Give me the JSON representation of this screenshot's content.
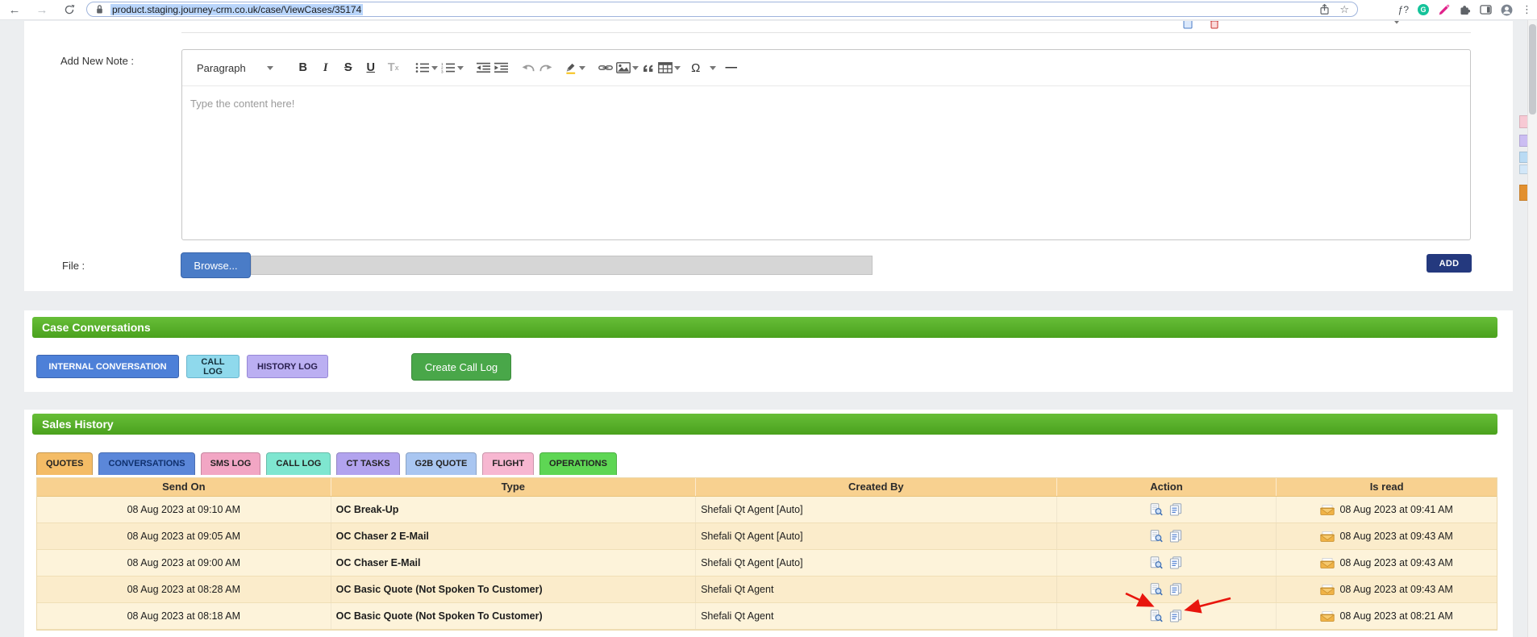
{
  "browser": {
    "url": "product.staging.journey-crm.co.uk/case/ViewCases/35174",
    "glyphs": {
      "back": "←",
      "forward": "→",
      "star": "☆",
      "menu": "⋮",
      "extension_monogram": "ƒ?",
      "grammarly_letter": "G"
    }
  },
  "note": {
    "label": "Add New Note :",
    "paragraph_dropdown": "Paragraph",
    "placeholder": "Type the content here!",
    "glyphs": {
      "bold": "B",
      "italic": "I",
      "strikethrough": "S",
      "underline": "U",
      "remove_format_t": "T",
      "remove_format_x": "x",
      "special_character": "Ω",
      "horizontal_line": "—"
    }
  },
  "file": {
    "label": "File :",
    "browse": "Browse...",
    "add": "ADD"
  },
  "conversations": {
    "title": "Case Conversations",
    "buttons": [
      {
        "label": "INTERNAL CONVERSATION",
        "color": "#4d80d8"
      },
      {
        "label": "CALL LOG",
        "color": "#8fd9ec"
      },
      {
        "label": "HISTORY LOG",
        "color": "#bbaff2"
      }
    ],
    "create_button": "Create Call Log"
  },
  "sales": {
    "title": "Sales History",
    "tabs": [
      {
        "label": "QUOTES",
        "active": true,
        "color": "#f4bc66"
      },
      {
        "label": "CONVERSATIONS",
        "color": "#5b87d9"
      },
      {
        "label": "SMS LOG",
        "color": "#f2a6c4"
      },
      {
        "label": "CALL LOG",
        "color": "#7fe6d0"
      },
      {
        "label": "CT TASKS",
        "color": "#b2a3ee"
      },
      {
        "label": "G2B QUOTE",
        "color": "#a9c6f1"
      },
      {
        "label": "FLIGHT",
        "color": "#f7b7d1"
      },
      {
        "label": "OPERATIONS",
        "color": "#5ed654"
      }
    ],
    "headers": [
      "Send On",
      "Type",
      "Created By",
      "Action",
      "Is read"
    ],
    "rows": [
      {
        "send_on": "08 Aug 2023 at 09:10 AM",
        "type": "OC Break-Up",
        "created_by": "Shefali Qt Agent [Auto]",
        "is_read": "08 Aug 2023 at 09:41 AM"
      },
      {
        "send_on": "08 Aug 2023 at 09:05 AM",
        "type": "OC Chaser 2 E-Mail",
        "created_by": "Shefali Qt Agent [Auto]",
        "is_read": "08 Aug 2023 at 09:43 AM"
      },
      {
        "send_on": "08 Aug 2023 at 09:00 AM",
        "type": "OC Chaser E-Mail",
        "created_by": "Shefali Qt Agent [Auto]",
        "is_read": "08 Aug 2023 at 09:43 AM"
      },
      {
        "send_on": "08 Aug 2023 at 08:28 AM",
        "type": "OC Basic Quote (Not Spoken To Customer)",
        "created_by": "Shefali Qt Agent",
        "is_read": "08 Aug 2023 at 09:43 AM"
      },
      {
        "send_on": "08 Aug 2023 at 08:18 AM",
        "type": "OC Basic Quote (Not Spoken To Customer)",
        "created_by": "Shefali Qt Agent",
        "is_read": "08 Aug 2023 at 08:21 AM"
      }
    ]
  },
  "colors": {
    "section_header_green": "#55b02a",
    "table_header": "#f8d190",
    "row_odd": "#fdf3da",
    "row_even": "#fbeccb",
    "browse_button": "#4a7cc7",
    "add_button": "#24397e",
    "create_button": "#49a749",
    "annotation_arrow_red": "#e8150d",
    "url_selection": "#b9d5fb"
  }
}
